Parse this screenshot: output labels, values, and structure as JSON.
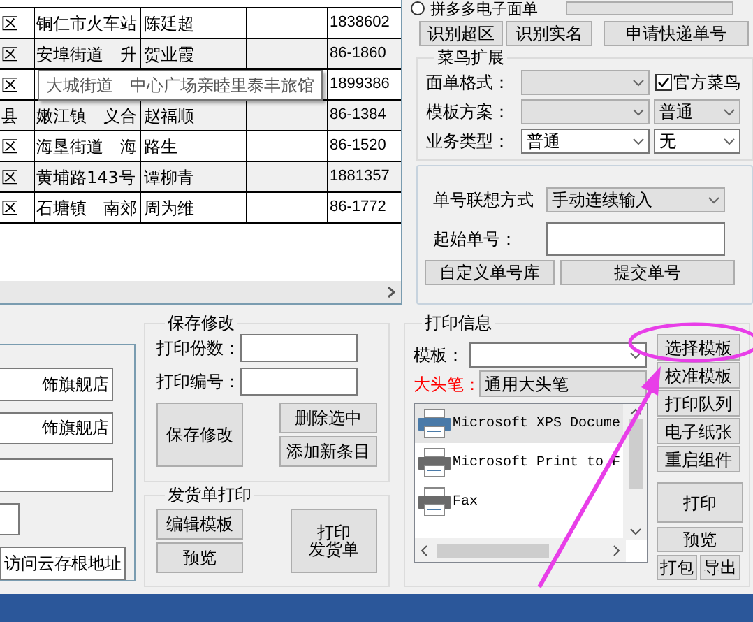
{
  "table": {
    "rows": [
      {
        "district": "区",
        "address": "铜仁市火车站",
        "name": "陈廷超",
        "phone": "1838602"
      },
      {
        "district": "区",
        "address": "安埠街道　升",
        "name": "贺业霞",
        "phone": "86-1860"
      },
      {
        "district": "区",
        "phone": "1899386"
      },
      {
        "district": "县",
        "address": "嫩江镇　义合",
        "name": "赵福顺",
        "phone": "86-1384"
      },
      {
        "district": "区",
        "address": "海垦街道　海",
        "name": "路生",
        "phone": "86-1520"
      },
      {
        "district": "区",
        "address": "黄埔路143号",
        "name": "谭柳青",
        "phone": "1881357"
      },
      {
        "district": "区",
        "address": "石塘镇　南郊",
        "name": "周为维",
        "phone": "86-1772"
      }
    ],
    "tooltip": "大城街道　中心广场亲睦里泰丰旅馆"
  },
  "express": {
    "radio": {
      "label": "拼多多电子面单",
      "selected": false
    },
    "buttons": [
      "识别超区",
      "识别实名",
      "申请快递单号"
    ]
  },
  "cainiao": {
    "title": "菜鸟扩展",
    "format_label": "面单格式：",
    "official": {
      "label": "官方菜鸟",
      "checked": true
    },
    "scheme_label": "模板方案：",
    "scheme_option": "普通",
    "type_label": "业务类型：",
    "type_value": "普通",
    "type_option": "无"
  },
  "numbers": {
    "mode_label": "单号联想方式",
    "mode_value": "手动连续输入",
    "start_label": "起始单号：",
    "buttons": [
      "自定义单号库",
      "提交单号"
    ]
  },
  "store": {
    "fields": [
      "饰旗舰店",
      "饰旗舰店"
    ],
    "button": "访问云存根地址"
  },
  "save": {
    "title": "保存修改",
    "copies_label": "打印份数：",
    "number_label": "打印编号：",
    "save_button": "保存修改",
    "delete_button": "删除选中",
    "add_button": "添加新条目"
  },
  "invoice": {
    "title": "发货单打印",
    "edit_button": "编辑模板",
    "preview_button": "预览",
    "print_button": [
      "打印",
      "发货单"
    ]
  },
  "print": {
    "title": "打印信息",
    "template_label": "模板：",
    "marker_label": "大头笔：",
    "marker_value": "通用大头笔",
    "printers": [
      {
        "name": "Microsoft XPS Docume",
        "selected": true
      },
      {
        "name": "Microsoft Print to F",
        "selected": false
      },
      {
        "name": "Fax",
        "selected": false
      }
    ],
    "side_buttons": [
      "选择模板",
      "校准模板",
      "打印队列",
      "电子纸张",
      "重启组件"
    ],
    "print_button": "打印",
    "preview_button": "预览",
    "pack_button": "打包",
    "export_button": "导出"
  }
}
